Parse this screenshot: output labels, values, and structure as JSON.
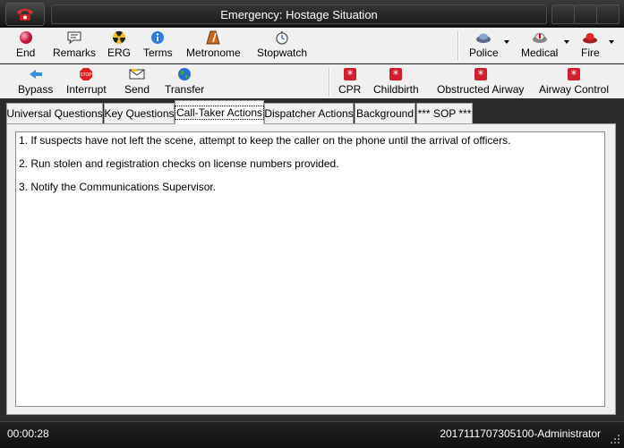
{
  "window": {
    "title": "Emergency: Hostage Situation"
  },
  "toolbar_top": {
    "end": "End",
    "remarks": "Remarks",
    "erg": "ERG",
    "terms": "Terms",
    "metronome": "Metronome",
    "stopwatch": "Stopwatch",
    "police": "Police",
    "medical": "Medical",
    "fire": "Fire"
  },
  "toolbar_bottom": {
    "bypass": "Bypass",
    "interrupt": "Interrupt",
    "send": "Send",
    "transfer": "Transfer",
    "cpr": "CPR",
    "childbirth": "Childbirth",
    "obstructed_airway": "Obstructed Airway",
    "airway_control": "Airway Control"
  },
  "tabs": [
    {
      "label": "Universal Questions"
    },
    {
      "label": "Key Questions"
    },
    {
      "label": "Call-Taker Actions"
    },
    {
      "label": "Dispatcher Actions"
    },
    {
      "label": "Background"
    },
    {
      "label": "*** SOP ***"
    }
  ],
  "content": {
    "lines": [
      "1.  If suspects have not left the scene, attempt to keep the caller on the phone until the arrival of officers.",
      "2.  Run stolen and registration checks on license numbers provided.",
      "3.  Notify the Communications Supervisor."
    ]
  },
  "status": {
    "timer": "00:00:28",
    "record": "20171117073051​00-Administrator"
  }
}
